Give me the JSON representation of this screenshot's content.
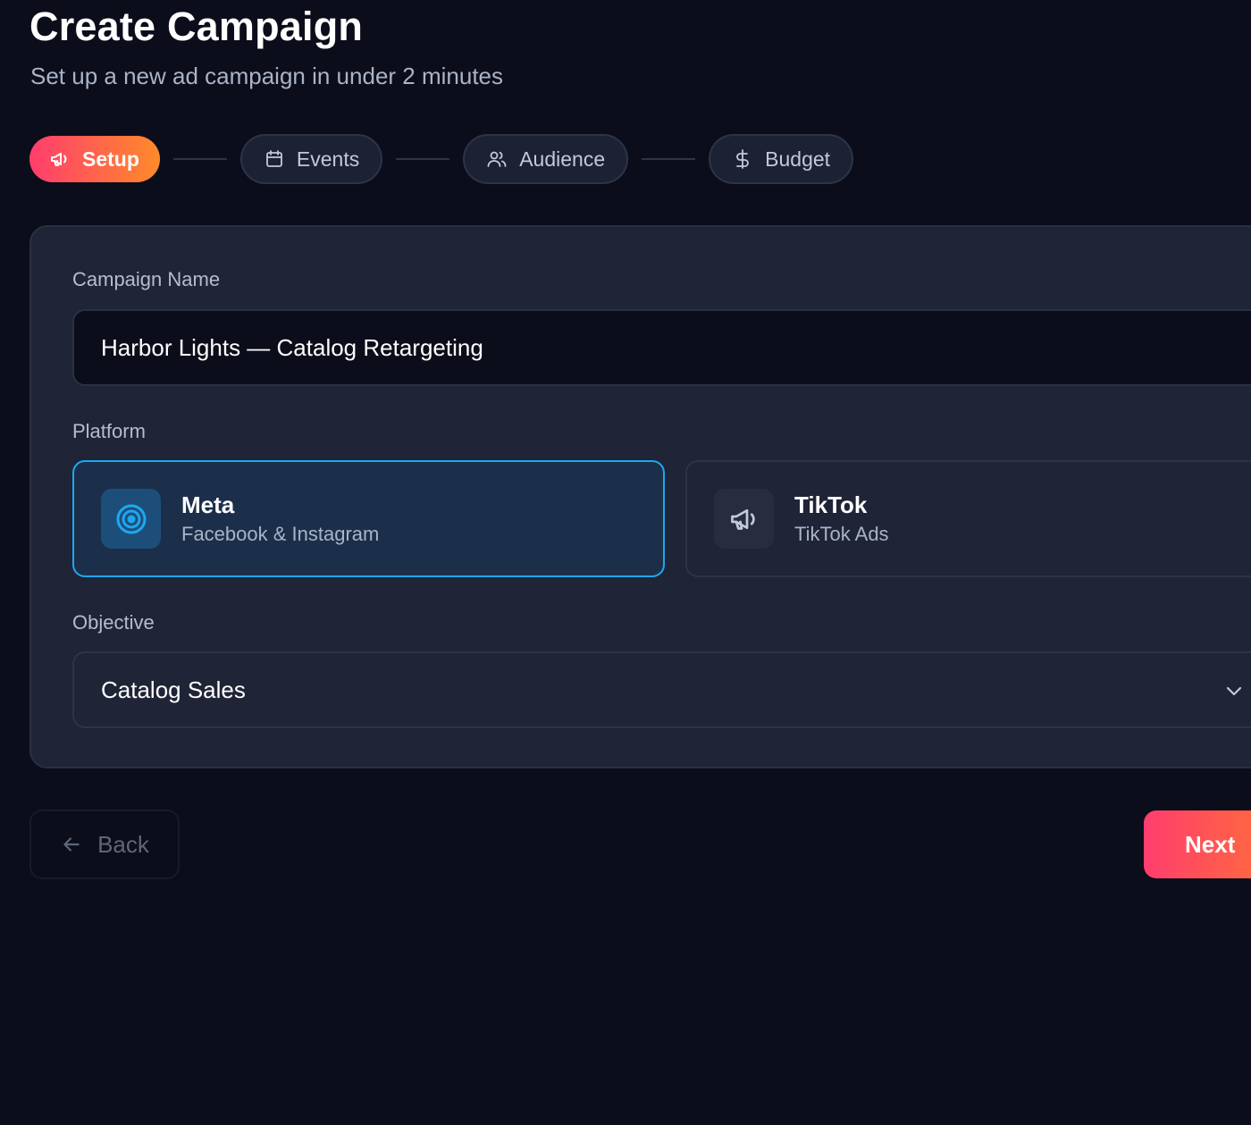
{
  "header": {
    "title": "Create Campaign",
    "subtitle": "Set up a new ad campaign in under 2 minutes"
  },
  "stepper": {
    "steps": [
      {
        "label": "Setup",
        "icon": "megaphone-icon",
        "active": true
      },
      {
        "label": "Events",
        "icon": "calendar-icon",
        "active": false
      },
      {
        "label": "Audience",
        "icon": "users-icon",
        "active": false
      },
      {
        "label": "Budget",
        "icon": "dollar-icon",
        "active": false
      }
    ]
  },
  "form": {
    "campaign_name": {
      "label": "Campaign Name",
      "value": "Harbor Lights — Catalog Retargeting"
    },
    "platform": {
      "label": "Platform",
      "options": [
        {
          "name": "Meta",
          "description": "Facebook & Instagram",
          "icon": "target-icon",
          "selected": true
        },
        {
          "name": "TikTok",
          "description": "TikTok Ads",
          "icon": "megaphone-icon",
          "selected": false
        }
      ]
    },
    "objective": {
      "label": "Objective",
      "value": "Catalog Sales"
    }
  },
  "footer": {
    "back_label": "Back",
    "next_label": "Next"
  },
  "colors": {
    "background": "#0b0d1a",
    "card": "#1f2436",
    "accent_gradient_start": "#ff3d6e",
    "accent_gradient_end": "#ff8a2a",
    "selected_border": "#1ea7f0",
    "selected_bg": "#1b2f4a"
  }
}
